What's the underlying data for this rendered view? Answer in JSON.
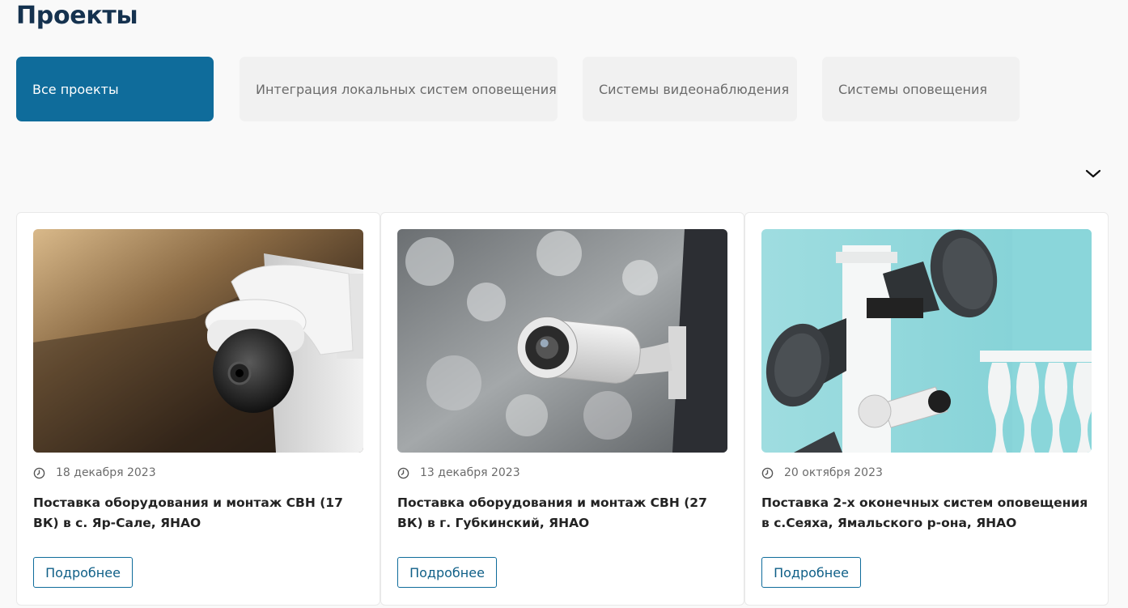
{
  "page": {
    "title": "Проекты"
  },
  "tabs": [
    {
      "label": "Все проекты",
      "active": true
    },
    {
      "label": "Интеграция локальных систем оповещения",
      "active": false
    },
    {
      "label": "Системы видеонаблюдения",
      "active": false
    },
    {
      "label": "Системы оповещения",
      "active": false
    }
  ],
  "expand": {
    "icon": "chevron-down-icon"
  },
  "cards": [
    {
      "image": "dome-camera-photo",
      "date": "18 декабря 2023",
      "title": "Поставка оборудования и монтаж СВН (17 ВК) в с. Яр-Сале, ЯНАО",
      "button": "Подробнее"
    },
    {
      "image": "bullet-camera-photo",
      "date": "13 декабря 2023",
      "title": "Поставка оборудования и монтаж СВН (27 ВК) в г. Губкинский, ЯНАО",
      "button": "Подробнее"
    },
    {
      "image": "loudspeakers-photo",
      "date": "20 октября 2023",
      "title": "Поставка 2-х оконечных систем оповещения в с.Сеяха, Ямальского р-она, ЯНАО",
      "button": "Подробнее"
    }
  ],
  "colors": {
    "accent": "#0f6c9b",
    "title": "#15324f",
    "tab_bg": "#f1f1f1"
  }
}
